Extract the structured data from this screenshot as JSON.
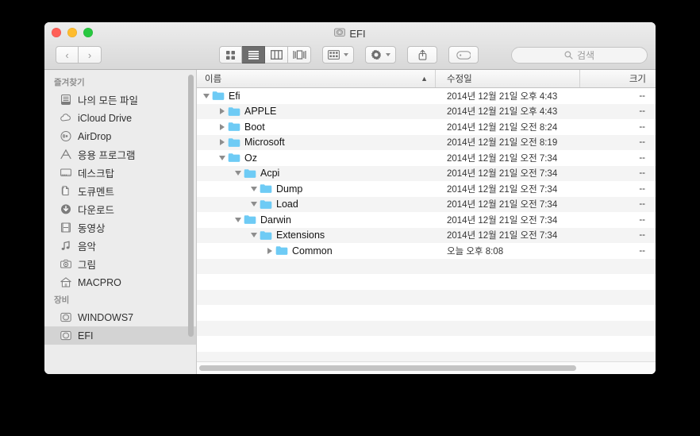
{
  "window": {
    "title": "EFI",
    "title_icon": "hard-drive-icon",
    "traffic_lights": [
      "close",
      "minimize",
      "zoom"
    ]
  },
  "toolbar": {
    "back_label": "‹",
    "forward_label": "›",
    "view_modes": [
      {
        "name": "icon-view",
        "active": false
      },
      {
        "name": "list-view",
        "active": true
      },
      {
        "name": "column-view",
        "active": false
      },
      {
        "name": "coverflow-view",
        "active": false
      }
    ],
    "arrange_button": "arrange-icon",
    "action_button": "gear-icon",
    "share_button": "share-icon",
    "tag_button": "tag-icon",
    "search": {
      "placeholder": "검색",
      "value": "",
      "icon": "search-icon"
    }
  },
  "sidebar": {
    "sections": [
      {
        "header": "즐겨찾기",
        "items": [
          {
            "label": "나의 모든 파일",
            "icon": "all-files-icon",
            "selected": false
          },
          {
            "label": "iCloud Drive",
            "icon": "cloud-icon",
            "selected": false
          },
          {
            "label": "AirDrop",
            "icon": "airdrop-icon",
            "selected": false
          },
          {
            "label": "응용 프로그램",
            "icon": "applications-icon",
            "selected": false
          },
          {
            "label": "데스크탑",
            "icon": "desktop-icon",
            "selected": false
          },
          {
            "label": "도큐멘트",
            "icon": "documents-icon",
            "selected": false
          },
          {
            "label": "다운로드",
            "icon": "downloads-icon",
            "selected": false
          },
          {
            "label": "동영상",
            "icon": "movies-icon",
            "selected": false
          },
          {
            "label": "음악",
            "icon": "music-icon",
            "selected": false
          },
          {
            "label": "그림",
            "icon": "pictures-icon",
            "selected": false
          },
          {
            "label": "MACPRO",
            "icon": "home-icon",
            "selected": false
          }
        ]
      },
      {
        "header": "장비",
        "items": [
          {
            "label": "WINDOWS7",
            "icon": "hard-drive-icon",
            "selected": false
          },
          {
            "label": "EFI",
            "icon": "hard-drive-icon",
            "selected": true
          }
        ]
      }
    ]
  },
  "filelist": {
    "columns": [
      {
        "label": "이름",
        "sorted": true,
        "sort_direction": "asc",
        "sort_glyph": "▲"
      },
      {
        "label": "수정일",
        "sorted": false
      },
      {
        "label": "크기",
        "sorted": false
      }
    ],
    "rows": [
      {
        "name": "Efi",
        "depth": 0,
        "expanded": true,
        "has_children": true,
        "date": "2014년 12월 21일 오후 4:43",
        "size": "--"
      },
      {
        "name": "APPLE",
        "depth": 1,
        "expanded": false,
        "has_children": true,
        "date": "2014년 12월 21일 오후 4:43",
        "size": "--"
      },
      {
        "name": "Boot",
        "depth": 1,
        "expanded": false,
        "has_children": true,
        "date": "2014년 12월 21일 오전 8:24",
        "size": "--"
      },
      {
        "name": "Microsoft",
        "depth": 1,
        "expanded": false,
        "has_children": true,
        "date": "2014년 12월 21일 오전 8:19",
        "size": "--"
      },
      {
        "name": "Oz",
        "depth": 1,
        "expanded": true,
        "has_children": true,
        "date": "2014년 12월 21일 오전 7:34",
        "size": "--"
      },
      {
        "name": "Acpi",
        "depth": 2,
        "expanded": true,
        "has_children": true,
        "date": "2014년 12월 21일 오전 7:34",
        "size": "--"
      },
      {
        "name": "Dump",
        "depth": 3,
        "expanded": true,
        "has_children": true,
        "date": "2014년 12월 21일 오전 7:34",
        "size": "--"
      },
      {
        "name": "Load",
        "depth": 3,
        "expanded": true,
        "has_children": true,
        "date": "2014년 12월 21일 오전 7:34",
        "size": "--"
      },
      {
        "name": "Darwin",
        "depth": 2,
        "expanded": true,
        "has_children": true,
        "date": "2014년 12월 21일 오전 7:34",
        "size": "--"
      },
      {
        "name": "Extensions",
        "depth": 3,
        "expanded": true,
        "has_children": true,
        "date": "2014년 12월 21일 오전 7:34",
        "size": "--"
      },
      {
        "name": "Common",
        "depth": 4,
        "expanded": false,
        "has_children": true,
        "date": "오늘 오후 8:08",
        "size": "--"
      }
    ],
    "empty_rows": 7
  },
  "colors": {
    "folder": "#6ecbf5",
    "selection": "#d3d3d3",
    "stripe": "#f4f4f4",
    "titlebar_top": "#ededed",
    "titlebar_bottom": "#d8d8d8"
  }
}
